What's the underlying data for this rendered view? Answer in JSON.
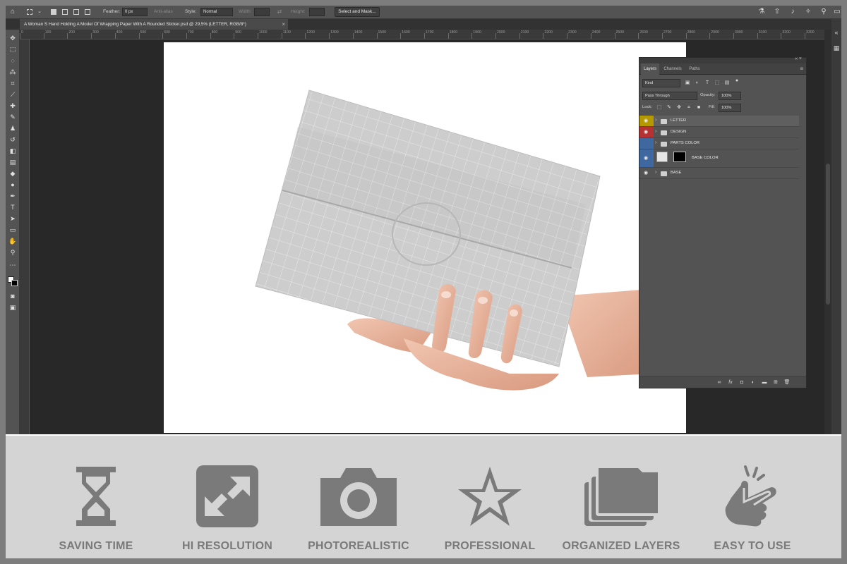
{
  "options_bar": {
    "feather_label": "Feather:",
    "feather_value": "0 px",
    "antialias_label": "Anti-alias",
    "style_label": "Style:",
    "style_value": "Normal",
    "width_label": "Width:",
    "height_label": "Height:",
    "select_mask_button": "Select and Mask..."
  },
  "document_tab": {
    "title": "A Woman S Hand Holding A Model Of Wrapping Paper With A Rounded Sticker.psd @ 29,5% (LETTER, RGB/8*)",
    "close": "×"
  },
  "ruler": {
    "top_marks": [
      "0",
      "100",
      "200",
      "300",
      "400",
      "500",
      "600",
      "700",
      "800",
      "900",
      "1000",
      "1100",
      "1200",
      "1300",
      "1400",
      "1500",
      "1600",
      "1700",
      "1800",
      "1900",
      "2000",
      "2100",
      "2200",
      "2300",
      "2400",
      "2500",
      "2600",
      "2700",
      "2800",
      "2900",
      "3000",
      "3100",
      "3200",
      "3300",
      "3400",
      "3500"
    ]
  },
  "layers_panel": {
    "tabs": [
      {
        "label": "Layers",
        "active": true
      },
      {
        "label": "Channels",
        "active": false
      },
      {
        "label": "Paths",
        "active": false
      }
    ],
    "filter_kind": "Kind",
    "blend_mode": "Pass Through",
    "opacity_label": "Opacity:",
    "opacity_value": "100%",
    "lock_label": "Lock:",
    "fill_label": "Fill:",
    "fill_value": "100%",
    "layers": [
      {
        "name": "LETTER",
        "color": "#b49a00",
        "visible": true,
        "type": "group",
        "selected": true
      },
      {
        "name": "DESIGN",
        "color": "#b43232",
        "visible": true,
        "type": "group",
        "selected": false
      },
      {
        "name": "PARTS COLOR",
        "color": "#3f67a0",
        "visible": false,
        "type": "group",
        "selected": false
      },
      {
        "name": "BASE COLOR",
        "color": "#3f67a0",
        "visible": true,
        "type": "layer",
        "selected": false
      },
      {
        "name": "BASE",
        "color": "",
        "visible": true,
        "type": "group",
        "selected": false
      }
    ]
  },
  "features": [
    {
      "label": "SAVING TIME",
      "icon": "hourglass-icon"
    },
    {
      "label": "HI RESOLUTION",
      "icon": "expand-arrows-icon"
    },
    {
      "label": "PHOTOREALISTIC",
      "icon": "camera-icon"
    },
    {
      "label": "PROFESSIONAL",
      "icon": "star-icon"
    },
    {
      "label": "ORGANIZED LAYERS",
      "icon": "stacked-layers-icon"
    },
    {
      "label": "EASY TO USE",
      "icon": "hand-click-icon"
    }
  ],
  "colors": {
    "footer_bg": "#d4d4d4",
    "footer_icon": "#7a7a7a",
    "app_bg": "#282828",
    "panel_bg": "#535353"
  }
}
